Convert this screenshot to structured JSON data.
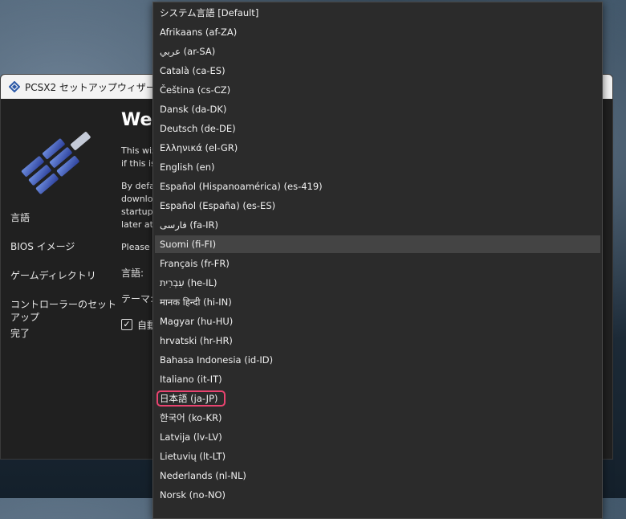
{
  "window": {
    "title": "PCSX2 セットアップウィザード"
  },
  "sidebar": {
    "items": [
      {
        "label": "言語"
      },
      {
        "label": "BIOS イメージ"
      },
      {
        "label": "ゲームディレクトリ"
      },
      {
        "label": "コントローラーのセットアップ"
      },
      {
        "label": "完了"
      }
    ]
  },
  "main": {
    "heading": "Wel",
    "line1": "This wiz",
    "line2": "if this is",
    "line3": "By defa",
    "line4": "downlo",
    "line5": "startup,",
    "line6": "later at",
    "line7": "Please c",
    "language_label": "言語:",
    "theme_label": "テーマ:",
    "auto_label": "自動",
    "checkbox_mark": "✓"
  },
  "dropdown": {
    "hovered_index": 12,
    "highlighted_index": 20,
    "highlight_color": "#e8436f",
    "options": [
      "システム言語 [Default]",
      "Afrikaans (af-ZA)",
      "عربي (ar-SA)",
      "Català (ca-ES)",
      "Čeština (cs-CZ)",
      "Dansk (da-DK)",
      "Deutsch (de-DE)",
      "Ελληνικά (el-GR)",
      "English (en)",
      "Español (Hispanoamérica) (es-419)",
      "Español (España) (es-ES)",
      "فارسی (fa-IR)",
      "Suomi (fi-FI)",
      "Français (fr-FR)",
      "עִבְרִית (he-IL)",
      "मानक हिन्दी (hi-IN)",
      "Magyar (hu-HU)",
      "hrvatski (hr-HR)",
      "Bahasa Indonesia (id-ID)",
      "Italiano (it-IT)",
      "日本語 (ja-JP)",
      "한국어 (ko-KR)",
      "Latvija (lv-LV)",
      "Lietuvių (lt-LT)",
      "Nederlands (nl-NL)",
      "Norsk (no-NO)"
    ]
  }
}
